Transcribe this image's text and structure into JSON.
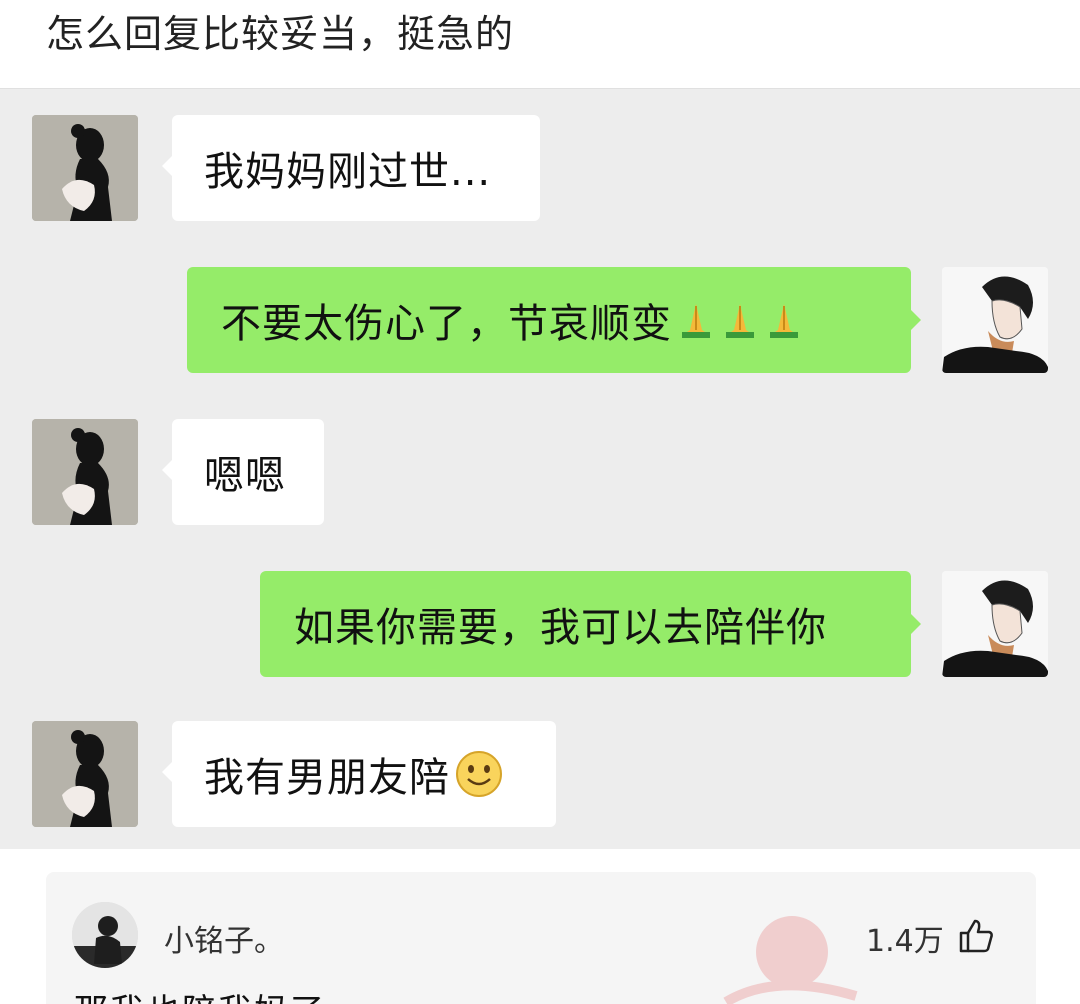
{
  "post": {
    "title": "怎么回复比较妥当，挺急的"
  },
  "chat": {
    "messages": [
      {
        "side": "incoming",
        "text": "我妈妈刚过世..."
      },
      {
        "side": "outgoing",
        "text": "不要太伤心了，节哀顺变",
        "emoji": [
          "pray-icon",
          "pray-icon",
          "pray-icon"
        ]
      },
      {
        "side": "incoming",
        "text": "嗯嗯"
      },
      {
        "side": "outgoing",
        "text": "如果你需要，我可以去陪伴你"
      },
      {
        "side": "incoming",
        "text": "我有男朋友陪",
        "emoji": [
          "smile-emoji-icon"
        ]
      }
    ]
  },
  "comment": {
    "author": "小铭子。",
    "likes": "1.4万",
    "text": "那我也陪我妈了",
    "like_icon": "thumbs-up-icon"
  },
  "colors": {
    "chat_background": "#ededed",
    "outgoing_bubble": "#95ec69",
    "incoming_bubble": "#ffffff"
  }
}
